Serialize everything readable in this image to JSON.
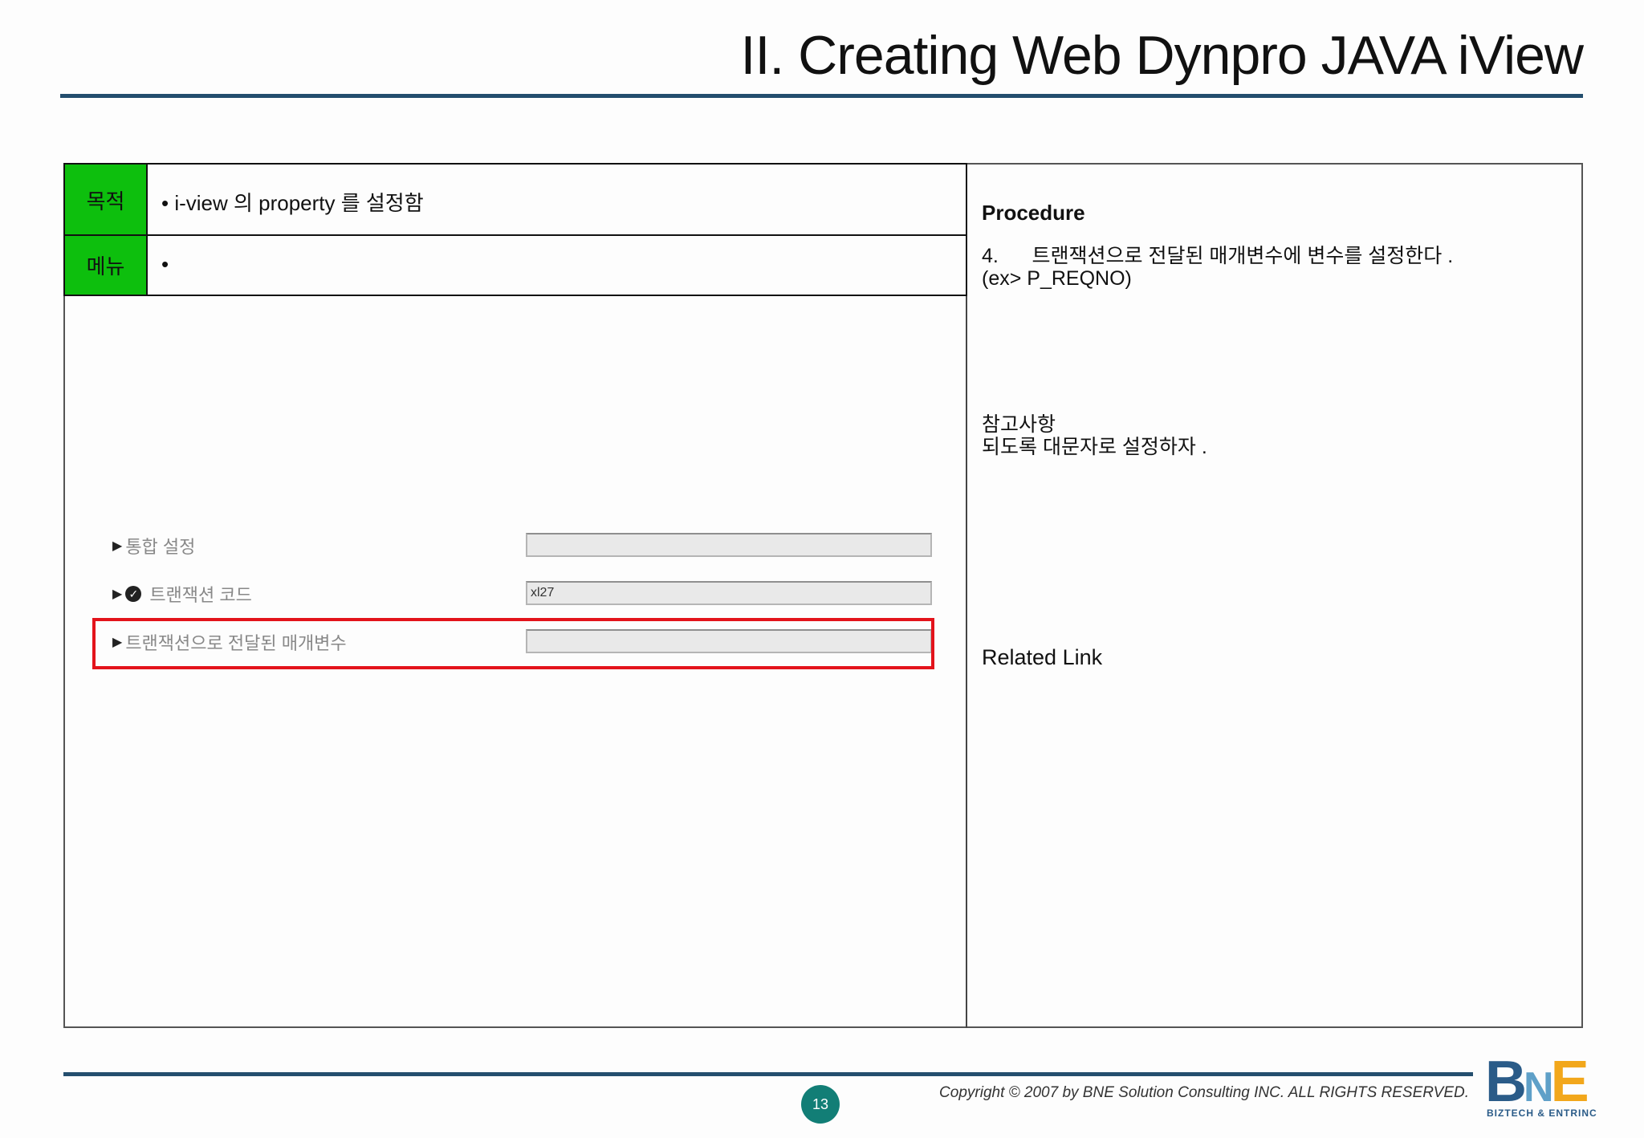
{
  "slide": {
    "title": "II. Creating Web Dynpro JAVA iView"
  },
  "table": {
    "purpose_label": "목적",
    "purpose_text": "• i-view 의  property 를 설정함",
    "menu_label": "메뉴",
    "menu_text": "•"
  },
  "screenshot": {
    "fields": [
      {
        "label": "통합 설정",
        "value": "",
        "required": false
      },
      {
        "label": "트랜잭션 코드",
        "value": "xl27",
        "required": true
      },
      {
        "label": "트랜잭션으로 전달된 매개변수",
        "value": "",
        "required": false
      }
    ]
  },
  "procedure": {
    "title": "Procedure",
    "text": "4.      트랜잭션으로 전달된 매개변수에 변수를 설정한다 .\n(ex> P_REQNO)"
  },
  "notes": {
    "title": "참고사항",
    "text": "되도록 대문자로 설정하자 ."
  },
  "related": {
    "title": "Related Link"
  },
  "footer": {
    "page_number": "13",
    "copyright": "Copyright © 2007 by BNE Solution Consulting INC.   ALL RIGHTS RESERVED."
  },
  "logo": {
    "b": "B",
    "n": "N",
    "e": "E",
    "subtitle": "BIZTECH & ENTRINC"
  },
  "colors": {
    "label_green": "#0dbf0d",
    "rule_blue": "#244e6e",
    "highlight_red": "#e3131b",
    "page_badge": "#127e76"
  }
}
